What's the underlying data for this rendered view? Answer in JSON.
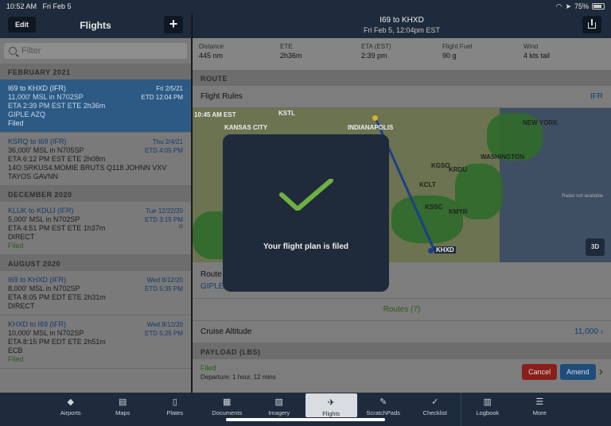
{
  "status": {
    "time": "10:52 AM",
    "date": "Fri Feb 5",
    "battery": "75%"
  },
  "left": {
    "edit": "Edit",
    "title": "Flights",
    "plus": "+",
    "search_placeholder": "Filter",
    "sections": [
      {
        "header": "FEBRUARY 2021"
      },
      {
        "header": "DECEMBER 2020"
      },
      {
        "header": "AUGUST 2020"
      }
    ],
    "flights": [
      {
        "route": "I69 to KHXD (IFR)",
        "date": "Fri 2/5/21",
        "alt": "11,000' MSL in N702SP",
        "etd": "ETD 12:04 PM",
        "eta": "ETA 2:39 PM EST ETE 2h36m",
        "path": "GIPLE AZQ",
        "status": "Filed"
      },
      {
        "route": "KSRQ to I69 (IFR)",
        "date": "Thu 2/4/21",
        "alt": "36,000' MSL in N705SP",
        "etd": "ETD 4:05 PM",
        "eta": "ETA 6:12 PM EST ETE 2h08m",
        "path": "14O.SRKUS4.MOMIE BRUTS Q118 JOHNN VXV",
        "path2": "TAYOS GAVNN"
      },
      {
        "route": "KLUK to KDUJ (IFR)",
        "date": "Tue 12/22/20",
        "alt": "5,000' MSL in N702SP",
        "etd": "ETD 3:15 PM",
        "eta": "ETA 4:51 PM EST ETE 1h37m",
        "path": "DIRECT",
        "status": "Filed"
      },
      {
        "route": "I69 to KHXD (IFR)",
        "date": "Wed 8/12/20",
        "alt": "8,000' MSL in N702SP",
        "etd": "ETD 5:35 PM",
        "eta": "ETA 8:05 PM EDT ETE 2h31m",
        "path": "DIRECT"
      },
      {
        "route": "KHXD to I69 (IFR)",
        "date": "Wed 8/12/20",
        "alt": "10,000' MSL in N702SP",
        "etd": "ETD 5:25 PM",
        "eta": "ETA 8:15 PM EDT ETE 2h51m",
        "path": "ECB",
        "status": "Filed"
      }
    ]
  },
  "right": {
    "title": "I69 to KHXD",
    "subtitle": "Fri Feb 5, 12:04pm EST",
    "stats": [
      {
        "label": "Distance",
        "value": "445 nm"
      },
      {
        "label": "ETE",
        "value": "2h36m"
      },
      {
        "label": "ETA (EST)",
        "value": "2:39 pm"
      },
      {
        "label": "Flight Fuel",
        "value": "90 g"
      },
      {
        "label": "Wind",
        "value": "4 kts tail"
      }
    ],
    "route_section": "ROUTE",
    "flight_rules_label": "Flight Rules",
    "flight_rules_value": "IFR",
    "map_time": "10:45 AM EST",
    "radar_note": "Radar not available",
    "map_labels": {
      "kansas": "KANSAS CITY",
      "indianapolis": "INDIANAPOLIS",
      "newyork": "NEW YORK",
      "washington": "WASHINGTON",
      "khxd": "KHXD",
      "kstl": "KSTL",
      "kgso": "KGSO",
      "krdu": "KRDU",
      "kclt": "KCLT",
      "kssc": "KSSC",
      "kmyr": "KMYR"
    },
    "btn3d": "3D",
    "route_label": "Route",
    "route_value": "GIPLE",
    "routes_link": "Routes (7)",
    "cruise_label": "Cruise Altitude",
    "cruise_value": "11,000",
    "payload_section": "PAYLOAD (LBS)",
    "filed": "Filed",
    "departure": "Departure: 1 hour, 12 mins",
    "cancel": "Cancel",
    "amend": "Amend"
  },
  "modal": {
    "message": "Your flight plan is filed"
  },
  "tabs": [
    "Airports",
    "Maps",
    "Plates",
    "Documents",
    "Imagery",
    "Flights",
    "ScratchPads",
    "Checklist",
    "Logbook",
    "More"
  ]
}
